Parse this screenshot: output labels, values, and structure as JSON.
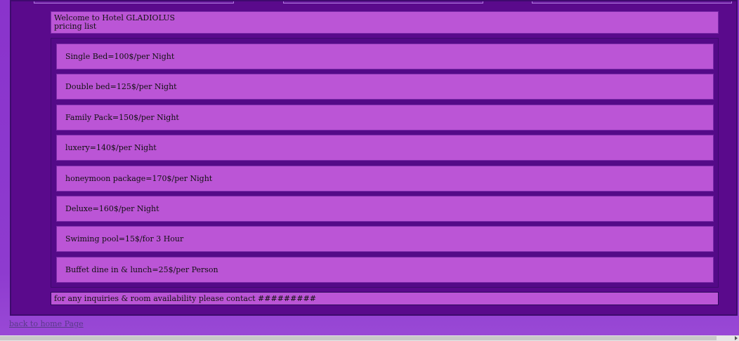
{
  "welcome": {
    "line1": "Welcome to Hotel GLADIOLUS",
    "line2": "pricing list"
  },
  "prices": [
    "Single Bed=100$/per Night",
    "Double bed=125$/per Night",
    "Family Pack=150$/per Night",
    "luxery=140$/per Night",
    "honeymoon package=170$/per Night",
    "Deluxe=160$/per Night",
    "Swiming pool=15$/for 3 Hour",
    "Buffet dine in & lunch=25$/per Person"
  ],
  "contact": "for any inquiries & room availability please contact #########",
  "back_link": "back to home Page"
}
